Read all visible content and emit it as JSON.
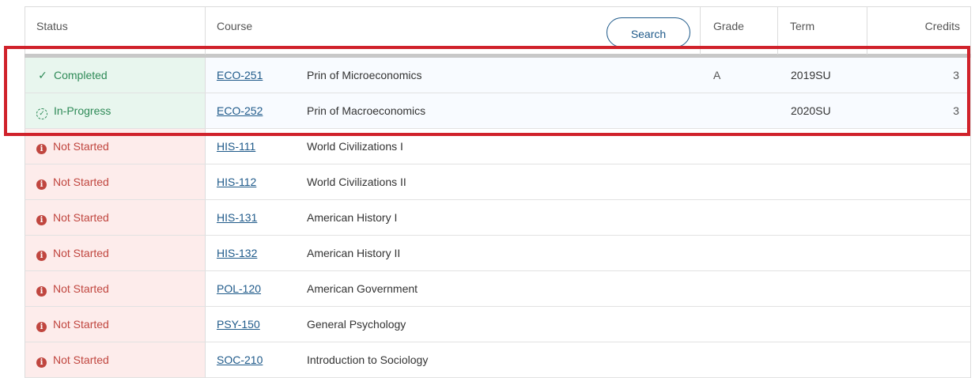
{
  "table": {
    "headers": {
      "status": "Status",
      "course": "Course",
      "grade": "Grade",
      "term": "Term",
      "credits": "Credits"
    },
    "search_label": "Search",
    "rows": [
      {
        "status": "Completed",
        "status_icon": "check-icon",
        "code": "ECO-251",
        "title": "Prin of Microeconomics",
        "grade": "A",
        "term": "2019SU",
        "credits": "3"
      },
      {
        "status": "In-Progress",
        "status_icon": "in-progress-icon",
        "code": "ECO-252",
        "title": "Prin of Macroeconomics",
        "grade": "",
        "term": "2020SU",
        "credits": "3"
      },
      {
        "status": "Not Started",
        "status_icon": "info-icon",
        "code": "HIS-111",
        "title": "World Civilizations I",
        "grade": "",
        "term": "",
        "credits": ""
      },
      {
        "status": "Not Started",
        "status_icon": "info-icon",
        "code": "HIS-112",
        "title": "World Civilizations II",
        "grade": "",
        "term": "",
        "credits": ""
      },
      {
        "status": "Not Started",
        "status_icon": "info-icon",
        "code": "HIS-131",
        "title": "American History I",
        "grade": "",
        "term": "",
        "credits": ""
      },
      {
        "status": "Not Started",
        "status_icon": "info-icon",
        "code": "HIS-132",
        "title": "American History II",
        "grade": "",
        "term": "",
        "credits": ""
      },
      {
        "status": "Not Started",
        "status_icon": "info-icon",
        "code": "POL-120",
        "title": "American Government",
        "grade": "",
        "term": "",
        "credits": ""
      },
      {
        "status": "Not Started",
        "status_icon": "info-icon",
        "code": "PSY-150",
        "title": "General Psychology",
        "grade": "",
        "term": "",
        "credits": ""
      },
      {
        "status": "Not Started",
        "status_icon": "info-icon",
        "code": "SOC-210",
        "title": "Introduction to Sociology",
        "grade": "",
        "term": "",
        "credits": ""
      }
    ]
  },
  "colors": {
    "completed_bg": "#e8f6ee",
    "completed_text": "#2e8a57",
    "not_started_bg": "#fdeceb",
    "not_started_text": "#c0463f",
    "link": "#1f5a8a",
    "highlight_border": "#d0222b"
  }
}
